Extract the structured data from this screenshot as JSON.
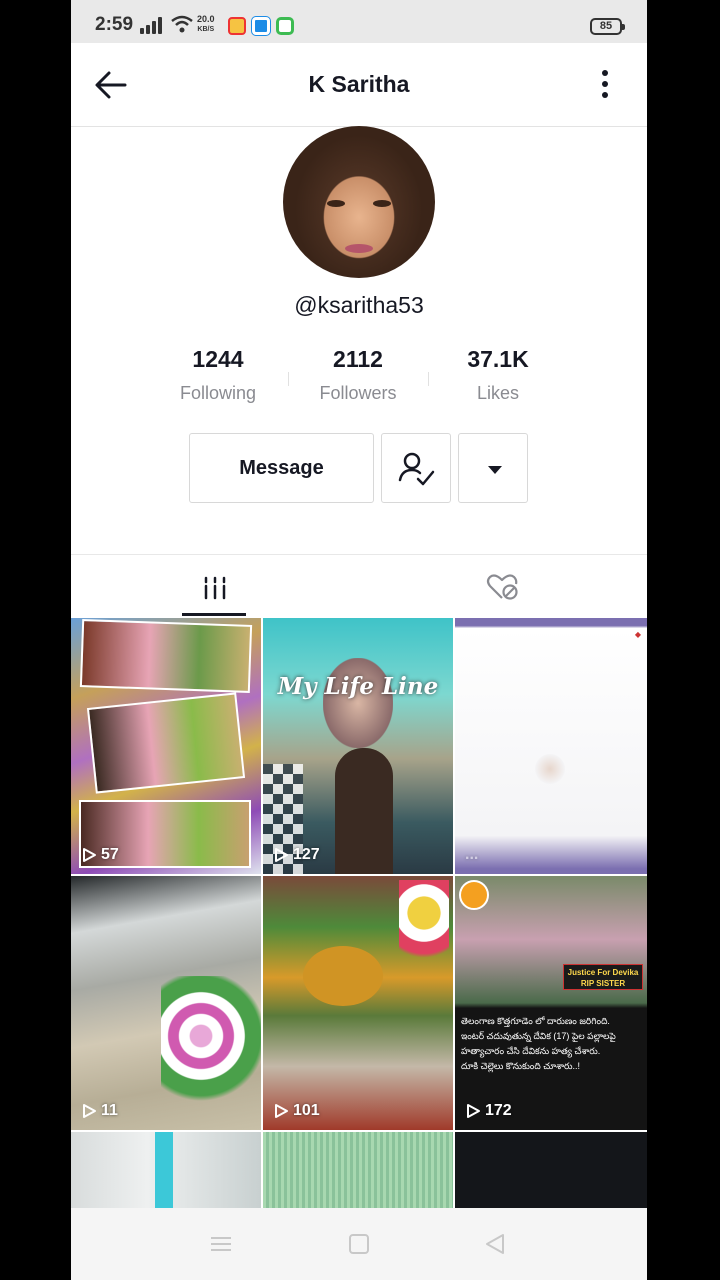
{
  "status_bar": {
    "time": "2:59",
    "net_speed_value": "20.0",
    "net_speed_unit": "KB/S",
    "battery": "85"
  },
  "header": {
    "title": "K Saritha"
  },
  "profile": {
    "username": "@ksaritha53",
    "stats": [
      {
        "value": "1244",
        "label": "Following"
      },
      {
        "value": "2112",
        "label": "Followers"
      },
      {
        "value": "37.1K",
        "label": "Likes"
      }
    ],
    "message_label": "Message"
  },
  "tabs": [
    {
      "icon": "videos-grid-icon",
      "active": true
    },
    {
      "icon": "liked-hidden-icon",
      "active": false
    }
  ],
  "videos": [
    {
      "views": "57"
    },
    {
      "views": "127",
      "caption": "My Life Line"
    },
    {
      "views": "..."
    },
    {
      "views": "11"
    },
    {
      "views": "101"
    },
    {
      "views": "172",
      "label_line1": "Justice For Devika",
      "label_line2": "RIP SISTER",
      "text_lines": [
        "తెలంగాణ కొత్తగూడెం లో దారుణం జరిగింది.",
        "ఇంటర్ చదువుతున్న దేవిక (17) పైల పల్లాలపై",
        "హత్యాచారం చేసి దేవికను హత్య చేశారు.",
        "దూకి చెల్లెలు కొనుకుంది చూశారు..!"
      ]
    },
    {
      "views": ""
    },
    {
      "views": ""
    },
    {
      "views": ""
    }
  ],
  "colors": {
    "text_primary": "#161823",
    "text_secondary": "#8a8b91",
    "divider": "#e3e3e3"
  }
}
